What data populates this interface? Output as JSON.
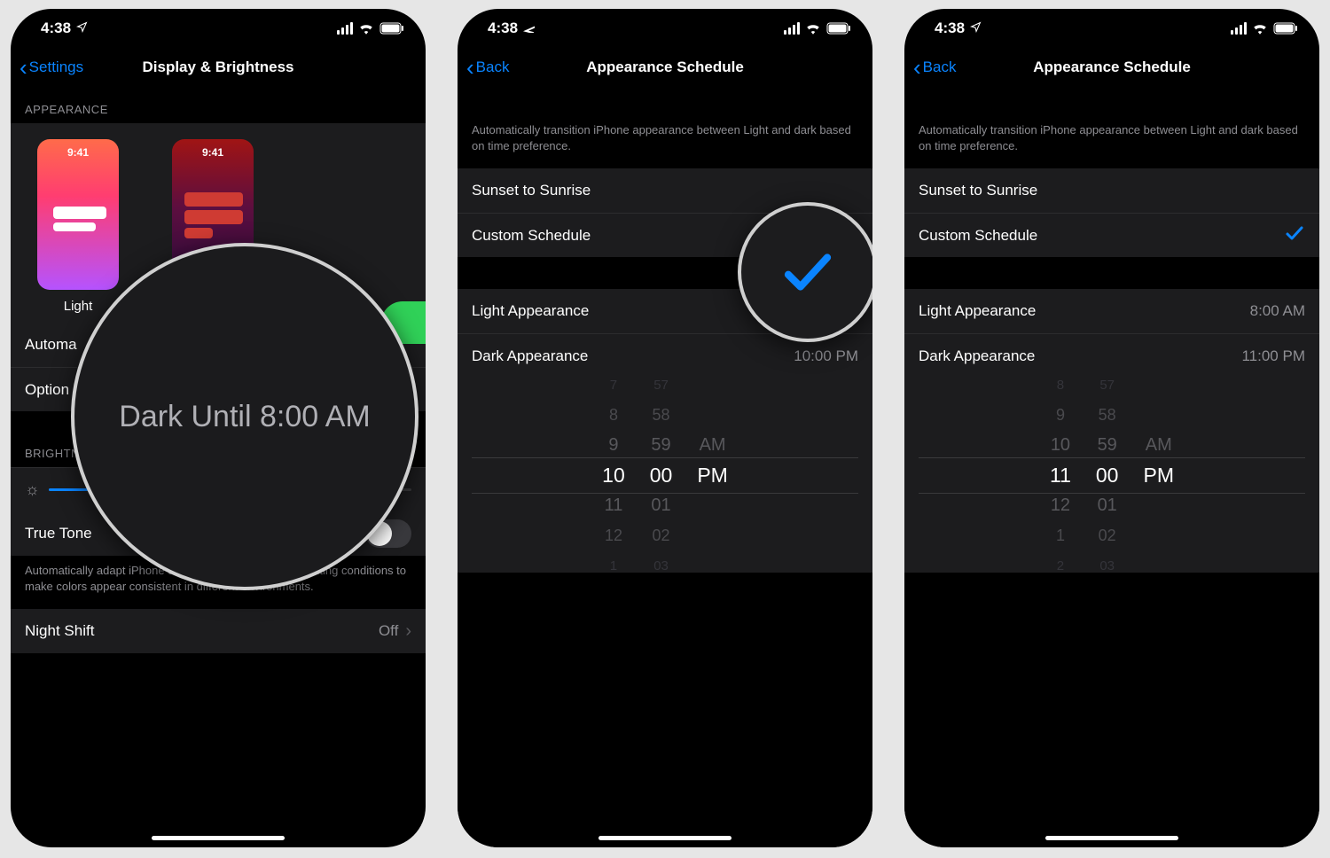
{
  "status": {
    "time": "4:38"
  },
  "screen1": {
    "back": "Settings",
    "title": "Display & Brightness",
    "appearance_header": "APPEARANCE",
    "light_label": "Light",
    "preview_clock": "9:41",
    "automatic_label": "Automa",
    "options_label": "Option",
    "zoom_text": "Dark Until 8:00 AM",
    "brightness_header": "BRIGHTNE",
    "true_tone_label": "True Tone",
    "true_tone_footer": "Automatically adapt iPhone display based on ambient lighting conditions to make colors appear consistent in different environments.",
    "night_shift_label": "Night Shift",
    "night_shift_value": "Off"
  },
  "shared": {
    "back": "Back",
    "title": "Appearance Schedule",
    "desc": "Automatically transition iPhone appearance between Light and dark based on time preference.",
    "sunset_label": "Sunset to Sunrise",
    "custom_label": "Custom Schedule",
    "light_row": "Light Appearance",
    "dark_row": "Dark Appearance",
    "light_time": "8:00 AM"
  },
  "screen2": {
    "dark_time": "10:00 PM",
    "wheel": {
      "hours": [
        "7",
        "8",
        "9",
        "10",
        "11",
        "12",
        "1"
      ],
      "minutes": [
        "57",
        "58",
        "59",
        "00",
        "01",
        "02",
        "03"
      ],
      "ampm": [
        "AM",
        "PM"
      ]
    }
  },
  "screen3": {
    "dark_time": "11:00 PM",
    "wheel": {
      "hours": [
        "8",
        "9",
        "10",
        "11",
        "12",
        "1",
        "2"
      ],
      "minutes": [
        "57",
        "58",
        "59",
        "00",
        "01",
        "02",
        "03"
      ],
      "ampm": [
        "AM",
        "PM"
      ]
    }
  }
}
